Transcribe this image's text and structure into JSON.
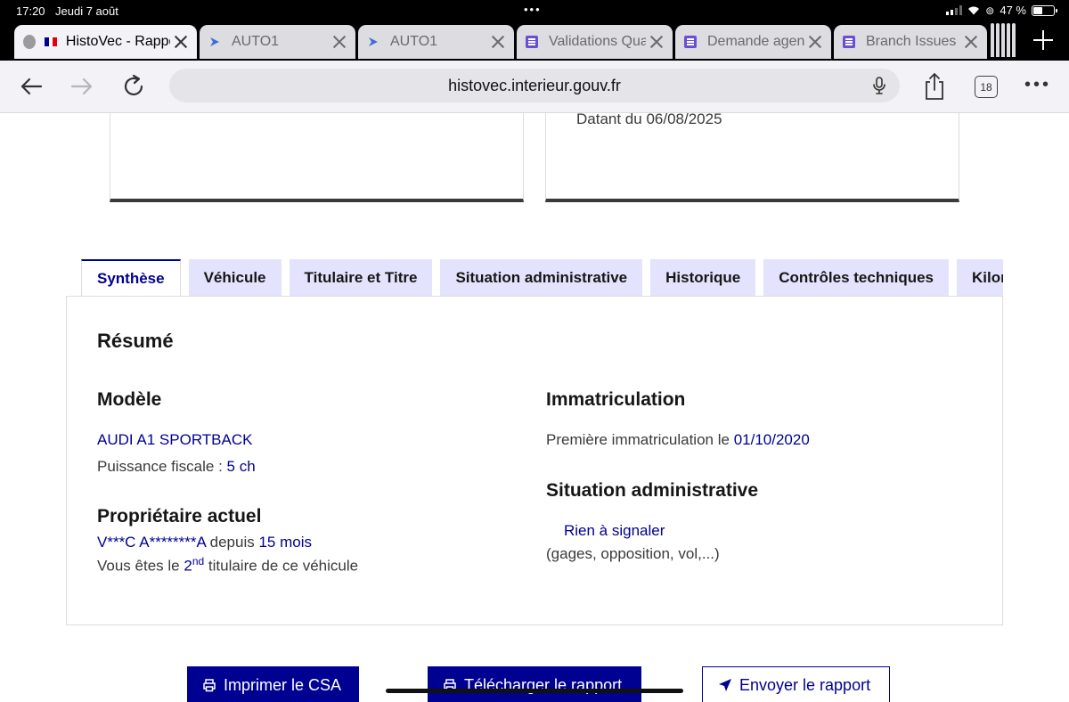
{
  "status_bar": {
    "time": "17:20",
    "date": "Jeudi 7 août",
    "battery": "47 %",
    "battery_level": 0.47
  },
  "browser": {
    "tabs": [
      {
        "label": "HistoVec - Rapport",
        "favicon": "globe-and-french-flag-icon",
        "active": true
      },
      {
        "label": "AUTO1",
        "favicon": "auto1-icon",
        "active": false
      },
      {
        "label": "AUTO1",
        "favicon": "auto1-icon",
        "active": false
      },
      {
        "label": "Validations Qualité",
        "favicon": "document-list-icon",
        "active": false
      },
      {
        "label": "Demande agent",
        "favicon": "document-list-icon",
        "active": false
      },
      {
        "label": "Branch Issues",
        "favicon": "document-list-icon",
        "active": false
      }
    ],
    "url": "histovec.interieur.gouv.fr",
    "tab_count": "18",
    "accent_color": "#000091"
  },
  "page": {
    "top_card_text": "Datant du 06/08/2025",
    "tabs": [
      {
        "label": "Synthèse",
        "active": true
      },
      {
        "label": "Véhicule",
        "active": false
      },
      {
        "label": "Titulaire et Titre",
        "active": false
      },
      {
        "label": "Situation administrative",
        "active": false
      },
      {
        "label": "Historique",
        "active": false
      },
      {
        "label": "Contrôles techniques",
        "active": false
      },
      {
        "label": "Kilométrage",
        "active": false
      }
    ],
    "summary": {
      "title": "Résumé",
      "model": {
        "heading": "Modèle",
        "name": "AUDI A1 SPORTBACK",
        "power_label": "Puissance fiscale : ",
        "power_value": "5 ch"
      },
      "owner": {
        "heading": "Propriétaire actuel",
        "name": "V***C A********A",
        "since_label": " depuis ",
        "since_value": "15 mois",
        "rank_prefix": "Vous êtes le ",
        "rank_num": "2",
        "rank_sup": "nd",
        "rank_suffix": " titulaire de ce véhicule"
      },
      "registration": {
        "heading": "Immatriculation",
        "label": "Première immatriculation le ",
        "date": "01/10/2020"
      },
      "admin": {
        "heading": "Situation administrative",
        "status": "Rien à signaler",
        "detail": "(gages, opposition, vol,...)"
      }
    },
    "actions": {
      "print": "Imprimer le CSA",
      "download": "Télécharger le rapport",
      "send": "Envoyer le rapport"
    }
  }
}
